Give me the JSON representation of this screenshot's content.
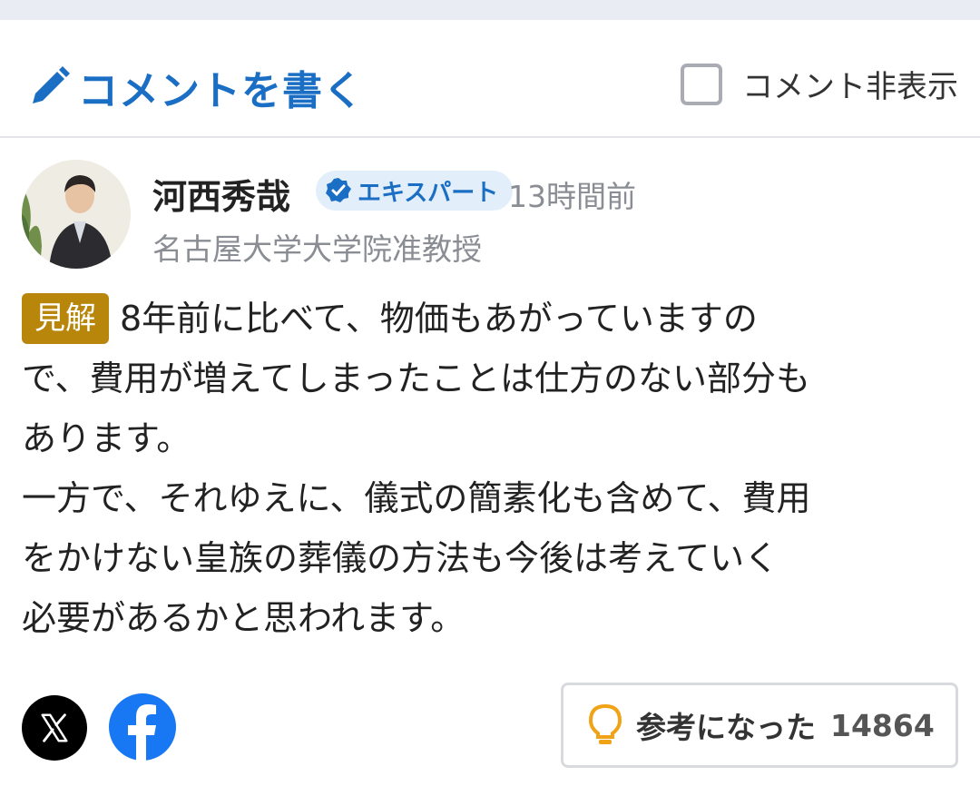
{
  "header": {
    "write_label": "コメントを書く",
    "hide_label": "コメント非表示",
    "accent": "#1a6fc4"
  },
  "comment": {
    "author": "河西秀哉",
    "badge": "エキスパート",
    "time": "13時間前",
    "title": "名古屋大学大学院准教授",
    "tag": "見解",
    "tag_color": "#b8860b",
    "lines": [
      "8年前に比べて、物価もあがっていますの",
      "で、費用が増えてしまったことは仕方のない部分も",
      "あります。",
      "一方で、それゆえに、儀式の簡素化も含めて、費用",
      "をかけない皇族の葬儀の方法も今後は考えていく",
      "必要があるかと思われます。"
    ]
  },
  "footer": {
    "share_icons": [
      "x-icon",
      "facebook-icon"
    ],
    "helpful_label": "参考になった",
    "helpful_count": "14864"
  }
}
